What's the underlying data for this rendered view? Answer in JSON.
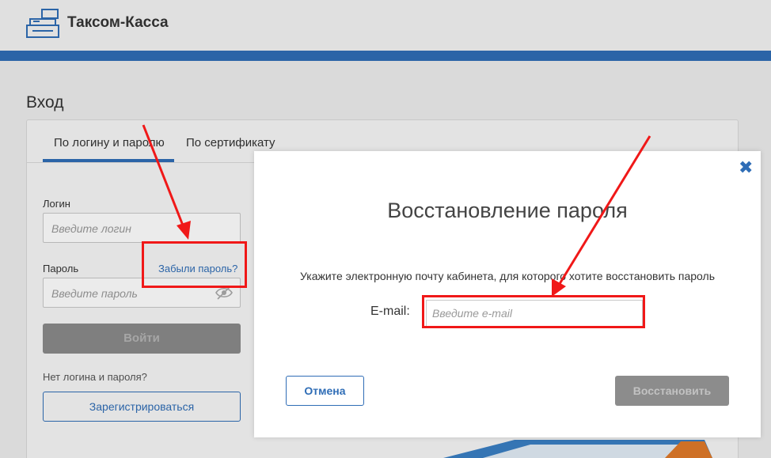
{
  "header": {
    "app_title": "Таксом-Касса",
    "logo_icon": "cash-register-icon"
  },
  "page": {
    "heading": "Вход"
  },
  "tabs": [
    {
      "label": "По логину и паролю",
      "active": true
    },
    {
      "label": "По сертификату",
      "active": false
    }
  ],
  "login_form": {
    "login_label": "Логин",
    "login_placeholder": "Введите логин",
    "password_label": "Пароль",
    "password_placeholder": "Введите пароль",
    "forgot_link": "Забыли пароль?",
    "eye_icon": "eye-off-icon",
    "submit_label": "Войти",
    "no_account_text": "Нет логина и пароля?",
    "register_label": "Зарегистрироваться"
  },
  "modal": {
    "title": "Восстановление пароля",
    "description": "Укажите электронную почту кабинета, для которого хотите восстановить пароль",
    "email_label": "E-mail:",
    "email_placeholder": "Введите e-mail",
    "cancel_label": "Отмена",
    "restore_label": "Восстановить",
    "close_icon": "close-icon",
    "close_glyph": "✖"
  },
  "colors": {
    "brand_blue": "#2f6db6",
    "annotation_red": "#f01818",
    "disabled_gray": "#8c8c8c"
  }
}
